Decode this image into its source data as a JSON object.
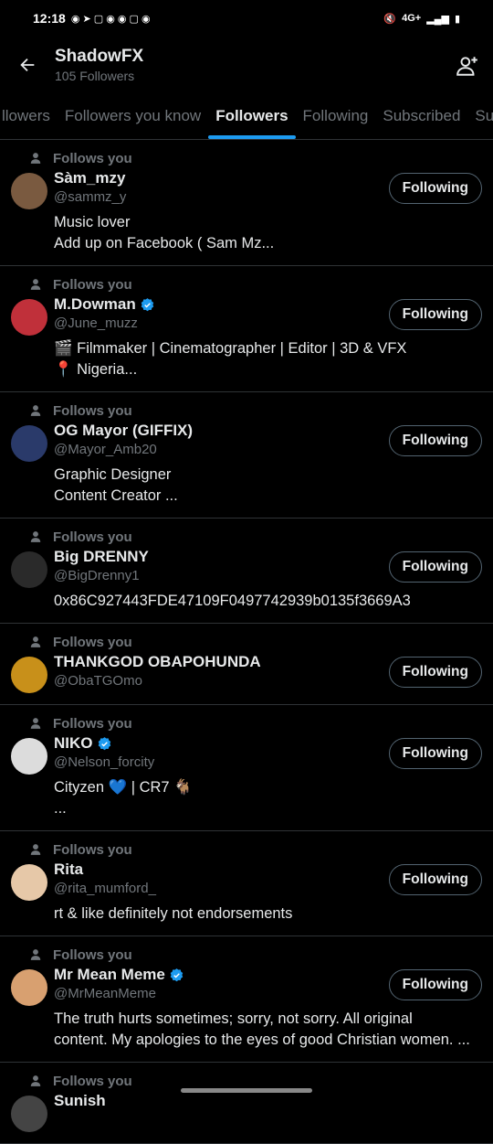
{
  "status": {
    "time": "12:18",
    "right_text": "4G+"
  },
  "header": {
    "title": "ShadowFX",
    "subtitle": "105 Followers"
  },
  "tabs": [
    "llowers",
    "Followers you know",
    "Followers",
    "Following",
    "Subscribed",
    "Su"
  ],
  "active_tab": "Followers",
  "follows_you_label": "Follows you",
  "button_label": "Following",
  "users": [
    {
      "name": "Sàm_mzy",
      "handle": "@sammz_y",
      "verified": false,
      "bio_lines": [
        "Music lover",
        "Add up on Facebook ( Sam Mz..."
      ],
      "avatar_color": "#7a5a40"
    },
    {
      "name": "M.Dowman",
      "handle": "@June_muzz",
      "verified": true,
      "bio_lines": [
        "🎬 Filmmaker | Cinematographer | Editor | 3D & VFX",
        "📍 Nigeria..."
      ],
      "avatar_color": "#c0303a"
    },
    {
      "name": "OG Mayor (GIFFIX)",
      "handle": "@Mayor_Amb20",
      "verified": false,
      "bio_lines": [
        "Graphic Designer",
        "Content Creator  ..."
      ],
      "avatar_color": "#2a3a6a"
    },
    {
      "name": "Big DRENNY",
      "handle": "@BigDrenny1",
      "verified": false,
      "bio_lines": [
        "0x86C927443FDE47109F0497742939b0135f3669A3"
      ],
      "avatar_color": "#2a2a2a"
    },
    {
      "name": "THANKGOD OBAPOHUNDA",
      "handle": "@ObaTGOmo",
      "verified": false,
      "bio_lines": [],
      "avatar_color": "#c8901a"
    },
    {
      "name": "NIKO",
      "handle": "@Nelson_forcity",
      "verified": true,
      "bio_lines": [
        "Cityzen 💙 | CR7 🐐",
        "..."
      ],
      "avatar_color": "#dcdcdc"
    },
    {
      "name": "Rita",
      "handle": "@rita_mumford_",
      "verified": false,
      "bio_lines": [
        "rt & like definitely not endorsements"
      ],
      "avatar_color": "#e6c8a8"
    },
    {
      "name": "Mr Mean Meme",
      "handle": "@MrMeanMeme",
      "verified": true,
      "bio_lines": [
        "The truth hurts sometimes; sorry, not sorry. All original",
        "content. My apologies to the eyes of good Christian women. ..."
      ],
      "avatar_color": "#d8a070"
    }
  ],
  "partial_user": {
    "name": "Sunish"
  },
  "colors": {
    "accent": "#1d9bf0",
    "background": "#000000",
    "secondary_text": "#71767b"
  }
}
